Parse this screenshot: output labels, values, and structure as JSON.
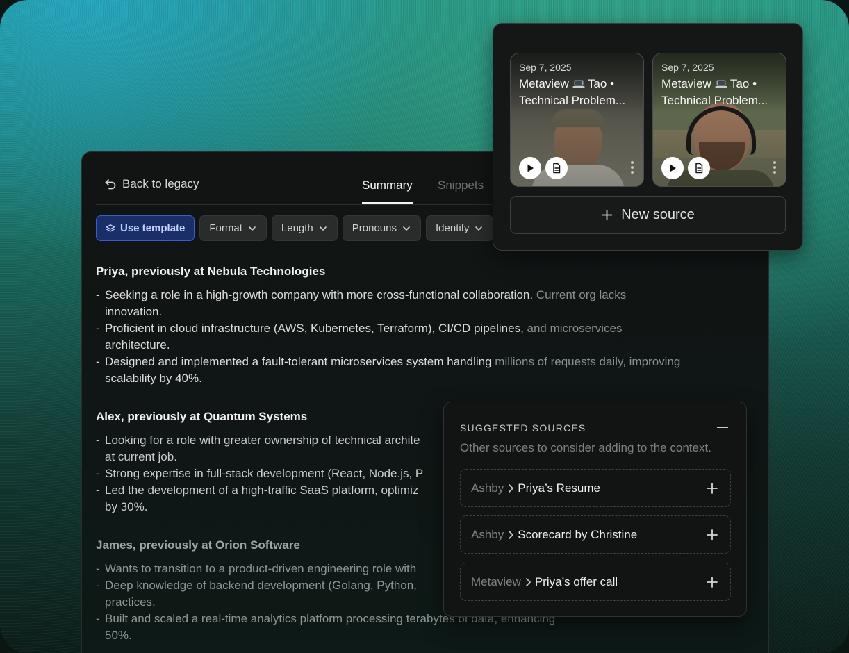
{
  "main": {
    "back_label": "Back to legacy",
    "tabs": [
      {
        "label": "Summary",
        "active": true
      },
      {
        "label": "Snippets",
        "active": false
      }
    ],
    "toolbar": {
      "use_template": "Use template",
      "filters": [
        "Format",
        "Length",
        "Pronouns",
        "Identify"
      ]
    },
    "candidates": [
      {
        "heading": "Priya, previously at Nebula Technologies",
        "bullets": [
          {
            "a": "Seeking a role in a high-growth company with more cross-functional collaboration. ",
            "b": "Current org lacks",
            "c": "innovation."
          },
          {
            "a": "Proficient in cloud infrastructure (AWS, Kubernetes, Terraform), CI/CD pipelines, ",
            "b": "and microservices",
            "c": "architecture."
          },
          {
            "a": "Designed and implemented a fault-tolerant microservices system handling ",
            "b": "millions of requests daily, improving",
            "c": "scalability by 40%."
          }
        ]
      },
      {
        "heading": "Alex, previously at Quantum Systems",
        "bullets": [
          {
            "a": "Looking for a role with greater ownership of technical archite",
            "c": "at current job."
          },
          {
            "a": "Strong expertise in full-stack development (React, Node.js, P",
            "c": ""
          },
          {
            "a": "Led the development of a high-traffic SaaS platform, optimiz",
            "c": "by 30%."
          }
        ]
      },
      {
        "heading": "James, previously at Orion Software",
        "bullets": [
          {
            "a": "Wants to transition to a product-driven engineering role with",
            "c": ""
          },
          {
            "a": "Deep knowledge of backend development (Golang, Python,",
            "c": "practices."
          },
          {
            "a": "Built and scaled a real-time analytics platform processing terabytes of data, enhancing",
            "c": "50%."
          }
        ]
      }
    ]
  },
  "sources": {
    "videos": [
      {
        "date": "Sep 7, 2025",
        "title_prefix": "Metaview",
        "title_suffix": "Tao •",
        "title_line2": "Technical Problem..."
      },
      {
        "date": "Sep 7, 2025",
        "title_prefix": "Metaview",
        "title_suffix": "Tao •",
        "title_line2": "Technical Problem..."
      }
    ],
    "new_source_label": "New source"
  },
  "suggested": {
    "title": "SUGGESTED SOURCES",
    "subtitle": "Other sources to consider adding to the context.",
    "items": [
      {
        "source": "Ashby",
        "name": "Priya’s Resume"
      },
      {
        "source": "Ashby",
        "name": "Scorecard by Christine"
      },
      {
        "source": "Metaview",
        "name": "Priya’s offer call"
      }
    ]
  }
}
